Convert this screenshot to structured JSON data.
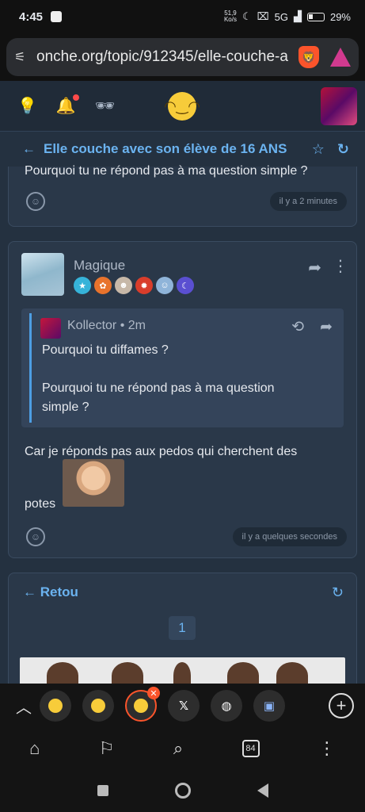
{
  "status": {
    "time": "4:45",
    "speed_value": "51,9",
    "speed_unit": "Ko/s",
    "network": "5G",
    "battery": "29%"
  },
  "browser": {
    "url": "onche.org/topic/912345/elle-couche-a",
    "tab_count": "84"
  },
  "topic": {
    "title": "Elle couche avec son élève de 16 ANS"
  },
  "prev_post": {
    "text": "Pourquoi tu ne répond pas à ma question simple ?",
    "time": "il y a 2 minutes"
  },
  "post": {
    "username": "Magique",
    "quote": {
      "username": "Kollector",
      "time": "• 2m",
      "line1": "Pourquoi tu diffames ?",
      "line2": "Pourquoi tu ne répond pas à ma question",
      "line3": "simple ?"
    },
    "body_line1": "Car je réponds pas aux pedos qui cherchent des",
    "body_line2": "potes",
    "time": "il y a quelques secondes"
  },
  "reply_card": {
    "title": "Retou",
    "page": "1"
  },
  "colors": {
    "accent": "#6bb3f0",
    "background": "#243140",
    "card": "#2a3849",
    "brave": "#fb542b"
  }
}
